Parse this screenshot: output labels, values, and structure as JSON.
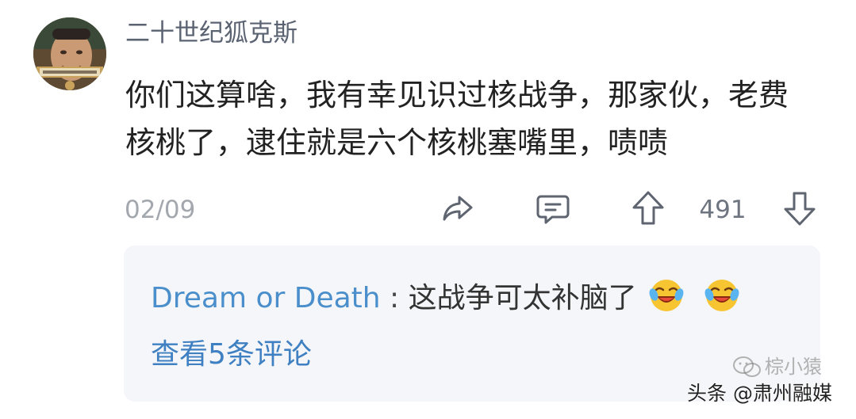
{
  "comment": {
    "username": "二十世纪狐克斯",
    "text": "你们这算啥，我有幸见识过核战争，那家伙，老费核桃了，逮住就是六个核桃塞嘴里，啧啧",
    "date": "02/09",
    "upvote_count": "491"
  },
  "reply_preview": {
    "author": "Dream or Death",
    "separator": ":",
    "text": "这战争可太补脑了",
    "emojis": [
      "laughing-tears-emoji",
      "laughing-tears-emoji"
    ],
    "view_more": "查看5条评论"
  },
  "watermark": {
    "text": "棕小猿",
    "source": "头条 @肃州融媒"
  },
  "icons": {
    "share": "share-icon",
    "comment": "comment-icon",
    "upvote": "upvote-icon",
    "downvote": "downvote-icon"
  },
  "colors": {
    "username": "#5b6372",
    "link": "#4a8fcb",
    "meta": "#a3a7ae",
    "reply_bg": "#f5f6f9"
  }
}
